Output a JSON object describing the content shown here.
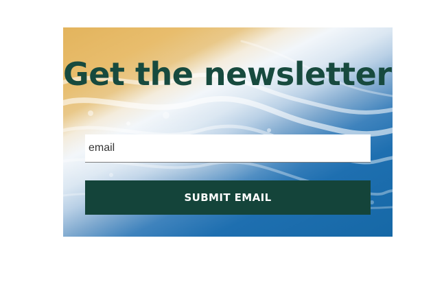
{
  "newsletter": {
    "headline": "Get the newsletter!",
    "email_value": "email",
    "submit_label": "SUBMIT EMAIL"
  },
  "colors": {
    "headline": "#174a3e",
    "button_bg": "#14443a",
    "button_text": "#ffffff",
    "sand": "#e3b45d",
    "ocean": "#1668a6"
  }
}
